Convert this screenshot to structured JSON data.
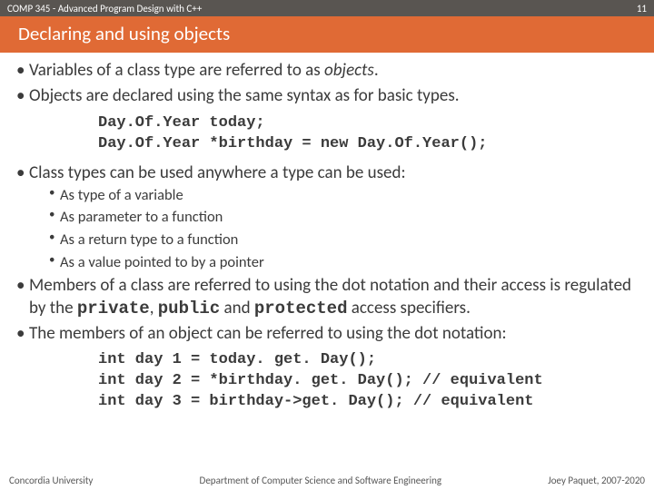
{
  "header": {
    "course": "COMP 345 - Advanced Program Design with C++",
    "page_number": "11",
    "title": "Declaring and using objects"
  },
  "bullets": {
    "b1a": "Variables of a class type are referred to as ",
    "b1b_italic": "objects",
    "b1c": ".",
    "b2": "Objects are declared using the same syntax as for basic types.",
    "code1_l1": "Day.Of.Year today;",
    "code1_l2": "Day.Of.Year *birthday = new Day.Of.Year();",
    "b3": "Class types can be used anywhere a type can be used:",
    "b3s1": "As type of a variable",
    "b3s2": "As parameter to a function",
    "b3s3": "As a return type to a function",
    "b3s4": "As a value pointed to by a pointer",
    "b4a": "Members of a class are referred to using the dot notation and their access is regulated by the ",
    "b4_kw1": "private",
    "b4b": ", ",
    "b4_kw2": "public",
    "b4c": " and ",
    "b4_kw3": "protected",
    "b4d": " access specifiers.",
    "b5": "The members of an object can be referred to using the dot notation:",
    "code2_l1": "int day 1 = today. get. Day();",
    "code2_l2": "int day 2 = *birthday. get. Day(); // equivalent",
    "code2_l3": "int day 3 = birthday->get. Day(); // equivalent"
  },
  "footer": {
    "left": "Concordia University",
    "center": "Department of Computer Science and Software Engineering",
    "right": "Joey Paquet, 2007-2020"
  }
}
